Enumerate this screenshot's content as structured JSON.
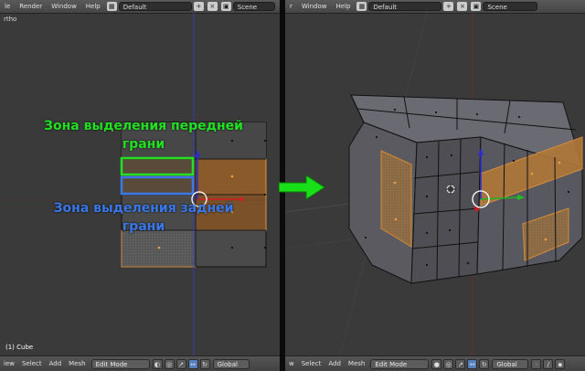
{
  "left": {
    "menus": [
      "le",
      "Render",
      "Window",
      "Help"
    ],
    "layout_value": "Default",
    "scene_value": "Scene",
    "view_label": "rtho",
    "object_name": "(1) Cube",
    "bottom_menus": [
      "iew",
      "Select",
      "Add",
      "Mesh"
    ],
    "mode": "Edit Mode",
    "orientation": "Global"
  },
  "right": {
    "menus": [
      "r",
      "Window",
      "Help"
    ],
    "layout_value": "Default",
    "scene_value": "Scene",
    "bottom_menus": [
      "w",
      "Select",
      "Add",
      "Mesh"
    ],
    "mode": "Edit Mode",
    "orientation": "Global"
  },
  "annotations": {
    "front_line1": "Зона выделения передней",
    "front_line2": "грани",
    "back_line1": "Зона выделения задней",
    "back_line2": "грани"
  },
  "colors": {
    "green": "#22e022",
    "blue": "#3a78e8",
    "selected_face": "#d68a35",
    "arrow": "#18e018"
  }
}
